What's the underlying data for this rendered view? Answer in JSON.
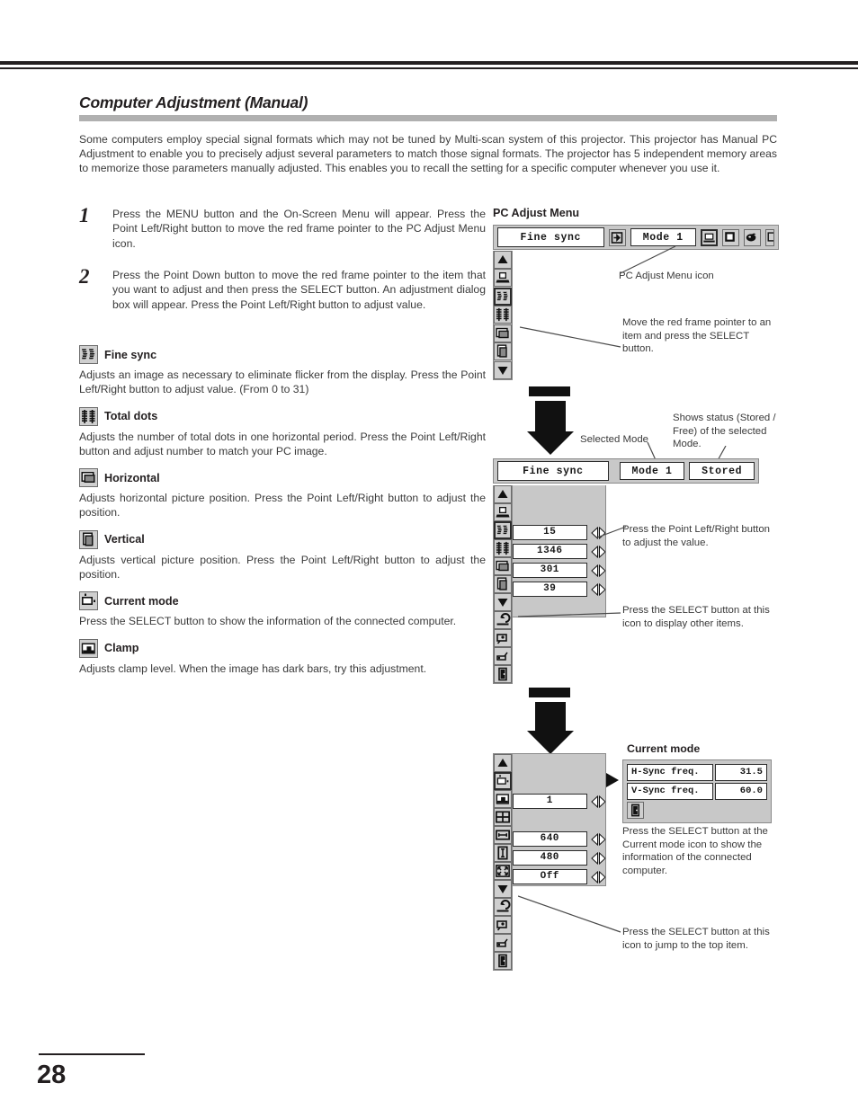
{
  "page": {
    "number": "28"
  },
  "header": {
    "title": "Computer Adjustment (Manual)"
  },
  "intro": "Some computers employ special signal formats which may not be tuned by Multi-scan system of this projector.  This projector has Manual PC Adjustment to enable you to precisely adjust several parameters to match those signal formats.  The projector has 5 independent memory areas to memorize those parameters manually adjusted.  This enables you to recall the setting for a specific computer whenever you use it.",
  "steps": [
    {
      "num": "1",
      "text": "Press the MENU button and the On-Screen Menu will appear. Press the Point Left/Right button to move the red frame pointer to the PC Adjust Menu icon."
    },
    {
      "num": "2",
      "text": "Press the Point Down button to move the red frame pointer to the item that you want to adjust and then press the SELECT button.  An adjustment dialog box will appear.  Press the Point Left/Right button to adjust value."
    }
  ],
  "sections": [
    {
      "icon": "fine-sync-icon",
      "title": "Fine sync",
      "body": "Adjusts an image as necessary to eliminate flicker from the display. Press the Point Left/Right button to adjust value.  (From 0 to 31)"
    },
    {
      "icon": "total-dots-icon",
      "title": "Total dots",
      "body": "Adjusts the number of total dots in one horizontal period.  Press the Point Left/Right button and adjust number to match your PC image."
    },
    {
      "icon": "horizontal-icon",
      "title": "Horizontal",
      "body": "Adjusts horizontal picture position.  Press the Point Left/Right button to adjust the position."
    },
    {
      "icon": "vertical-icon",
      "title": "Vertical",
      "body": "Adjusts vertical picture position.  Press the Point Left/Right button to adjust the position."
    },
    {
      "icon": "current-mode-icon",
      "title": "Current mode",
      "body": "Press the SELECT button to show the information of the connected computer."
    },
    {
      "icon": "clamp-icon",
      "title": "Clamp",
      "body": "Adjusts clamp level.  When the image has dark bars, try this adjustment."
    }
  ],
  "osd": {
    "heading": "PC Adjust Menu",
    "menu_bar": {
      "title": "Fine sync",
      "mode": "Mode 1"
    },
    "dialog": {
      "title": "Fine sync",
      "mode": "Mode 1",
      "status": "Stored"
    },
    "values": [
      {
        "icon": "fine-sync-icon",
        "value": "15"
      },
      {
        "icon": "total-dots-icon",
        "value": "1346"
      },
      {
        "icon": "horizontal-icon",
        "value": "301"
      },
      {
        "icon": "vertical-icon",
        "value": "39"
      }
    ],
    "values2": [
      {
        "icon": "clamp-icon",
        "value": "1"
      },
      {
        "icon": "area-h-icon",
        "value": "640"
      },
      {
        "icon": "area-v-icon",
        "value": "480"
      },
      {
        "icon": "full-screen-icon",
        "value": "Off"
      }
    ],
    "current_mode": {
      "title": "Current mode",
      "rows": [
        {
          "label": "H-Sync freq.",
          "value": "31.5"
        },
        {
          "label": "V-Sync freq.",
          "value": "60.0"
        }
      ]
    }
  },
  "annotations": {
    "pc_adjust_icon": "PC Adjust Menu icon",
    "move_pointer": "Move the red frame pointer to an item and press the SELECT button.",
    "selected_mode": "Selected Mode",
    "shows_status": "Shows status (Stored / Free) of the selected Mode.",
    "adjust_value": "Press the Point Left/Right button to adjust the value.",
    "display_other": "Press the SELECT button at this icon to display other items.",
    "current_mode_info": "Press the SELECT button at the Current mode icon to show the information of the connected computer.",
    "jump_top": "Press the SELECT button at this icon to jump to the top item."
  }
}
